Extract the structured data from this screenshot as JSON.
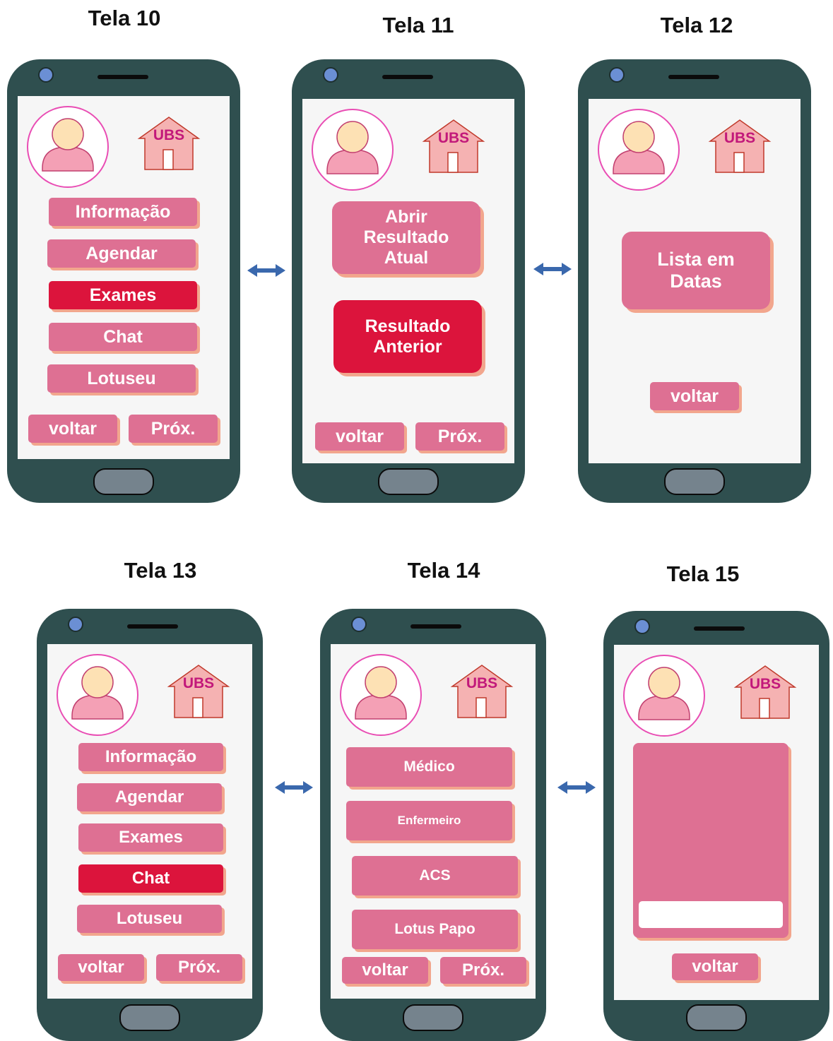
{
  "titles": {
    "t10": "Tela 10",
    "t11": "Tela 11",
    "t12": "Tela 12",
    "t13": "Tela 13",
    "t14": "Tela 14",
    "t15": "Tela 15"
  },
  "ubs_label": "UBS",
  "tela10": {
    "menu": [
      "Informação",
      "Agendar",
      "Exames",
      "Chat",
      "Lotuseu"
    ],
    "active": "Exames",
    "back": "voltar",
    "next": "Próx."
  },
  "tela11": {
    "open_current": "Abrir\nResultado\nAtual",
    "previous": "Resultado\nAnterior",
    "back": "voltar",
    "next": "Próx."
  },
  "tela12": {
    "list_dates": "Lista em\nDatas",
    "back": "voltar"
  },
  "tela13": {
    "menu": [
      "Informação",
      "Agendar",
      "Exames",
      "Chat",
      "Lotuseu"
    ],
    "active": "Chat",
    "back": "voltar",
    "next": "Próx."
  },
  "tela14": {
    "contacts": [
      "Médico",
      "Enfermeiro",
      "ACS",
      "Lotus Papo"
    ],
    "back": "voltar",
    "next": "Próx."
  },
  "tela15": {
    "back": "voltar"
  },
  "colors": {
    "phone_body": "#2f4f4f",
    "button": "#de7093",
    "button_active": "#dc143c",
    "button_shadow": "#f2a68d",
    "arrow": "#3a68ad"
  },
  "icons": [
    "user-avatar-icon",
    "ubs-house-icon",
    "double-arrow-icon",
    "camera-icon",
    "home-button-icon"
  ]
}
